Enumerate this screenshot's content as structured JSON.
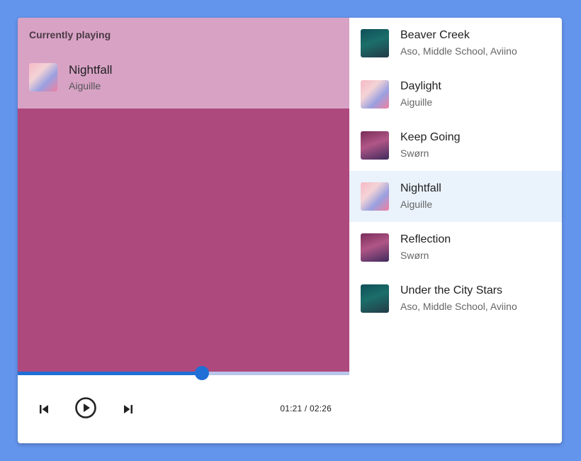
{
  "now_playing": {
    "label": "Currently playing",
    "title": "Nightfall",
    "artist": "Aiguille",
    "cover": "pink"
  },
  "player": {
    "progress_fraction": 0.555,
    "time_display": "01:21 / 02:26",
    "prev_icon": "skip-previous-icon",
    "play_icon": "play-circle-icon",
    "next_icon": "skip-next-icon"
  },
  "colors": {
    "background": "#6495ed",
    "header": "#d8a2c5",
    "art": "#ae497e",
    "accent": "#1f6fd6",
    "active_row": "#eaf2fb"
  },
  "playlist": [
    {
      "title": "Beaver Creek",
      "artist": "Aso, Middle School, Aviino",
      "cover": "green",
      "active": false
    },
    {
      "title": "Daylight",
      "artist": "Aiguille",
      "cover": "pink",
      "active": false
    },
    {
      "title": "Keep Going",
      "artist": "Swørn",
      "cover": "purple",
      "active": false
    },
    {
      "title": "Nightfall",
      "artist": "Aiguille",
      "cover": "pink",
      "active": true
    },
    {
      "title": "Reflection",
      "artist": "Swørn",
      "cover": "purple",
      "active": false
    },
    {
      "title": "Under the City Stars",
      "artist": "Aso, Middle School, Aviino",
      "cover": "green",
      "active": false
    }
  ]
}
